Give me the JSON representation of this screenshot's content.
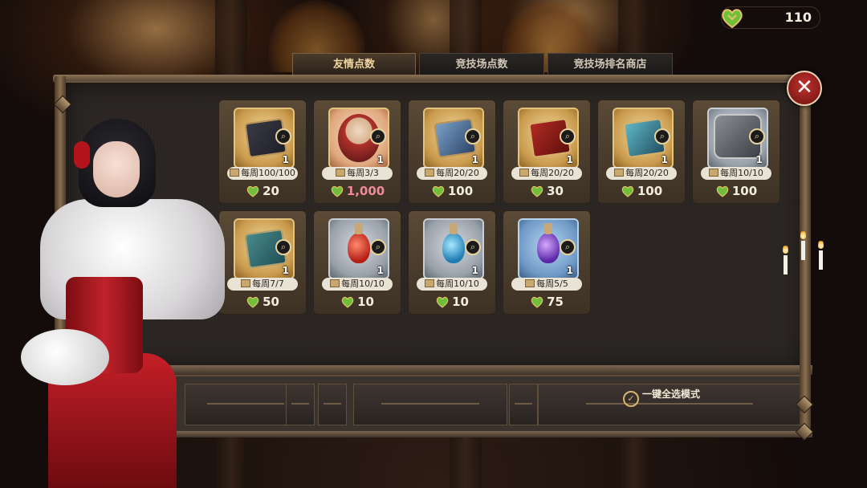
{
  "currency": {
    "icon": "friendship-heart-icon",
    "value": "110"
  },
  "tabs": [
    {
      "label": "友情点数",
      "active": true
    },
    {
      "label": "竞技场点数",
      "active": false
    },
    {
      "label": "竞技场排名商店",
      "active": false
    }
  ],
  "items": [
    {
      "icon": "skin-card-dark-icon",
      "quantity": "1",
      "limit": "每周100/100",
      "price": "20"
    },
    {
      "icon": "character-portrait-icon",
      "quantity": "1",
      "limit": "每周3/3",
      "price": "1,000"
    },
    {
      "icon": "spirit-card-icon",
      "quantity": "1",
      "limit": "每周20/20",
      "price": "100"
    },
    {
      "icon": "rose-card-icon",
      "quantity": "1",
      "limit": "每周20/20",
      "price": "30"
    },
    {
      "icon": "gem-card-icon",
      "quantity": "1",
      "limit": "每周20/20",
      "price": "100"
    },
    {
      "icon": "armor-set-icon",
      "quantity": "1",
      "limit": "每周10/10",
      "price": "100"
    },
    {
      "icon": "map-scroll-icon",
      "quantity": "1",
      "limit": "每周7/7",
      "price": "50"
    },
    {
      "icon": "red-potion-icon",
      "quantity": "1",
      "limit": "每周10/10",
      "price": "10"
    },
    {
      "icon": "blue-potion-icon",
      "quantity": "1",
      "limit": "每周10/10",
      "price": "10"
    },
    {
      "icon": "purple-potion-icon",
      "quantity": "1",
      "limit": "每周5/5",
      "price": "75"
    }
  ],
  "select_all": {
    "label": "一键全选模式"
  },
  "close": {
    "icon": "close-icon"
  }
}
